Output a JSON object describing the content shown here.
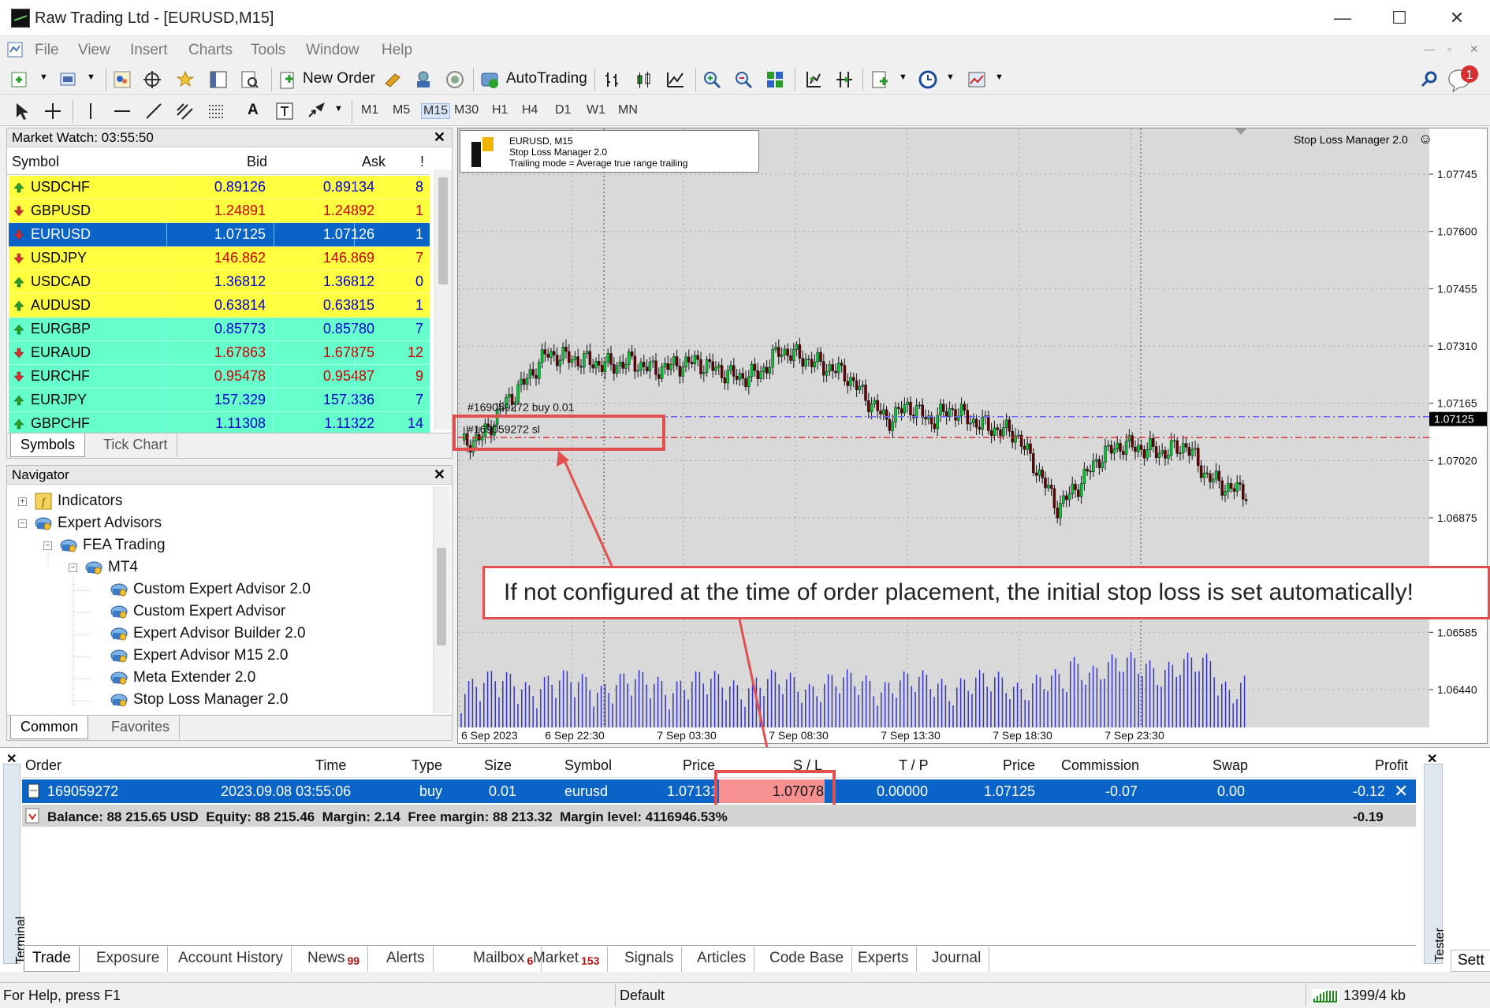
{
  "window": {
    "title": "Raw Trading Ltd - [EURUSD,M15]",
    "minimize": "—",
    "maximize": "☐",
    "close": "✕"
  },
  "menu": [
    "File",
    "View",
    "Insert",
    "Charts",
    "Tools",
    "Window",
    "Help"
  ],
  "toolbar": {
    "new_order": "New Order",
    "autotrading": "AutoTrading",
    "notification_count": "1"
  },
  "timeframes": [
    "M1",
    "M5",
    "M15",
    "M30",
    "H1",
    "H4",
    "D1",
    "W1",
    "MN"
  ],
  "market_watch": {
    "title": "Market Watch: 03:55:50",
    "headers": {
      "symbol": "Symbol",
      "bid": "Bid",
      "ask": "Ask",
      "spread": "!"
    },
    "rows": [
      {
        "symbol": "USDCHF",
        "bid": "0.89126",
        "ask": "0.89134",
        "spread": "8",
        "dir": "up",
        "bg": "#ffff40",
        "fg": "#0000cc"
      },
      {
        "symbol": "GBPUSD",
        "bid": "1.24891",
        "ask": "1.24892",
        "spread": "1",
        "dir": "down",
        "bg": "#ffff40",
        "fg": "#cc0000"
      },
      {
        "symbol": "EURUSD",
        "bid": "1.07125",
        "ask": "1.07126",
        "spread": "1",
        "dir": "down",
        "bg": "#0a64c8",
        "fg": "#ffffff"
      },
      {
        "symbol": "USDJPY",
        "bid": "146.862",
        "ask": "146.869",
        "spread": "7",
        "dir": "down",
        "bg": "#ffff40",
        "fg": "#cc0000"
      },
      {
        "symbol": "USDCAD",
        "bid": "1.36812",
        "ask": "1.36812",
        "spread": "0",
        "dir": "up",
        "bg": "#ffff40",
        "fg": "#0000cc"
      },
      {
        "symbol": "AUDUSD",
        "bid": "0.63814",
        "ask": "0.63815",
        "spread": "1",
        "dir": "up",
        "bg": "#ffff40",
        "fg": "#0000cc"
      },
      {
        "symbol": "EURGBP",
        "bid": "0.85773",
        "ask": "0.85780",
        "spread": "7",
        "dir": "up",
        "bg": "#66ffcc",
        "fg": "#0000cc"
      },
      {
        "symbol": "EURAUD",
        "bid": "1.67863",
        "ask": "1.67875",
        "spread": "12",
        "dir": "down",
        "bg": "#66ffcc",
        "fg": "#cc0000"
      },
      {
        "symbol": "EURCHF",
        "bid": "0.95478",
        "ask": "0.95487",
        "spread": "9",
        "dir": "down",
        "bg": "#66ffcc",
        "fg": "#cc0000"
      },
      {
        "symbol": "EURJPY",
        "bid": "157.329",
        "ask": "157.336",
        "spread": "7",
        "dir": "up",
        "bg": "#66ffcc",
        "fg": "#0000cc"
      },
      {
        "symbol": "GBPCHF",
        "bid": "1.11308",
        "ask": "1.11322",
        "spread": "14",
        "dir": "up",
        "bg": "#66ffcc",
        "fg": "#0000cc"
      }
    ],
    "tabs": [
      "Symbols",
      "Tick Chart"
    ]
  },
  "navigator": {
    "title": "Navigator",
    "items": [
      {
        "label": "Indicators"
      },
      {
        "label": "Expert Advisors"
      },
      {
        "label": "FEA Trading"
      },
      {
        "label": "MT4"
      },
      {
        "label": "Custom Expert Advisor 2.0"
      },
      {
        "label": "Custom Expert Advisor"
      },
      {
        "label": "Expert Advisor Builder 2.0"
      },
      {
        "label": "Expert Advisor M15 2.0"
      },
      {
        "label": "Meta Extender 2.0"
      },
      {
        "label": "Stop Loss Manager 2.0"
      }
    ],
    "tabs": [
      "Common",
      "Favorites"
    ]
  },
  "chart": {
    "info_symbol": "EURUSD, M15",
    "info_ea": "Stop Loss Manager 2.0",
    "info_mode": "Trailing mode = Average true range trailing",
    "ea_label": "Stop Loss Manager 2.0",
    "order_label": "#169059272 buy 0.01",
    "sl_label": "#169059272 sl",
    "current_price": "1.07125",
    "price_ticks": [
      "1.07745",
      "1.07600",
      "1.07455",
      "1.07310",
      "1.07165",
      "1.07020",
      "1.06875",
      "1.06585",
      "1.06440"
    ],
    "time_ticks": [
      "6 Sep 2023",
      "6 Sep 22:30",
      "7 Sep 03:30",
      "7 Sep 08:30",
      "7 Sep 13:30",
      "7 Sep 18:30",
      "7 Sep 23:30"
    ],
    "callout": "If not configured at the time of order placement, the initial stop loss is set automatically!",
    "colors": {
      "bg": "#d9d9d9",
      "bull": "#00cc33",
      "bear": "#660000",
      "volume": "#3333cc",
      "order_line": "#6666ff",
      "sl_line": "#dd3333",
      "callout": "#e14f4f"
    }
  },
  "terminal": {
    "side_label": "Terminal",
    "tester_label": "Tester",
    "headers": [
      "Order",
      "Time",
      "Type",
      "Size",
      "Symbol",
      "Price",
      "S / L",
      "T / P",
      "Price",
      "Commission",
      "Swap",
      "Profit"
    ],
    "order": {
      "id": "169059272",
      "time": "2023.09.08 03:55:06",
      "type": "buy",
      "size": "0.01",
      "symbol": "eurusd",
      "price": "1.07131",
      "sl": "1.07078",
      "tp": "0.00000",
      "cur_price": "1.07125",
      "commission": "-0.07",
      "swap": "0.00",
      "profit": "-0.12"
    },
    "balance_line": "Balance: 88 215.65 USD  Equity: 88 215.46  Margin: 2.14  Free margin: 88 213.32  Margin level: 4116946.53%",
    "balance_profit": "-0.19",
    "tabs": [
      {
        "label": "Trade",
        "badge": ""
      },
      {
        "label": "Exposure",
        "badge": ""
      },
      {
        "label": "Account History",
        "badge": ""
      },
      {
        "label": "News",
        "badge": "99"
      },
      {
        "label": "Alerts",
        "badge": ""
      },
      {
        "label": "Mailbox",
        "badge": "6"
      },
      {
        "label": "Market",
        "badge": "153"
      },
      {
        "label": "Signals",
        "badge": ""
      },
      {
        "label": "Articles",
        "badge": ""
      },
      {
        "label": "Code Base",
        "badge": ""
      },
      {
        "label": "Experts",
        "badge": ""
      },
      {
        "label": "Journal",
        "badge": ""
      }
    ],
    "sett_tab": "Sett"
  },
  "status": {
    "help": "For Help, press F1",
    "profile": "Default",
    "traffic": "1399/4 kb"
  }
}
